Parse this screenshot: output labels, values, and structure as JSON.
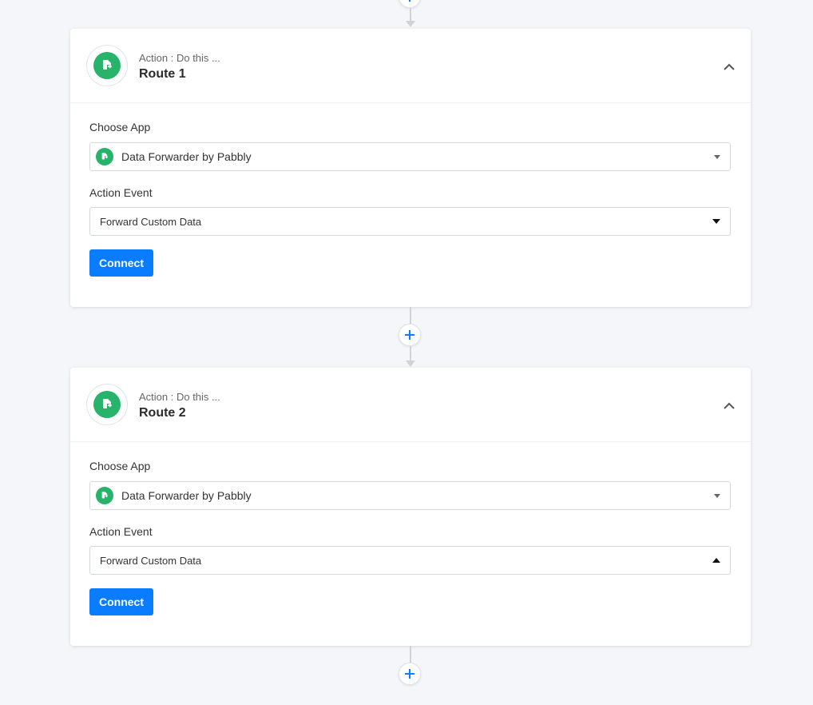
{
  "colors": {
    "accent": "#0a7cff",
    "app_green": "#27b36a",
    "background": "#f4f6f9",
    "connector": "#cfd3d8"
  },
  "icons": {
    "app": "data-forwarder-icon",
    "collapse": "chevron-up-icon",
    "add": "plus-icon"
  },
  "routes": [
    {
      "subtitle": "Action : Do this ...",
      "title": "Route 1",
      "choose_app_label": "Choose App",
      "app_value": "Data Forwarder by Pabbly",
      "action_event_label": "Action Event",
      "event_value": "Forward Custom Data",
      "connect_label": "Connect"
    },
    {
      "subtitle": "Action : Do this ...",
      "title": "Route 2",
      "choose_app_label": "Choose App",
      "app_value": "Data Forwarder by Pabbly",
      "action_event_label": "Action Event",
      "event_value": "Forward Custom Data",
      "connect_label": "Connect"
    }
  ]
}
